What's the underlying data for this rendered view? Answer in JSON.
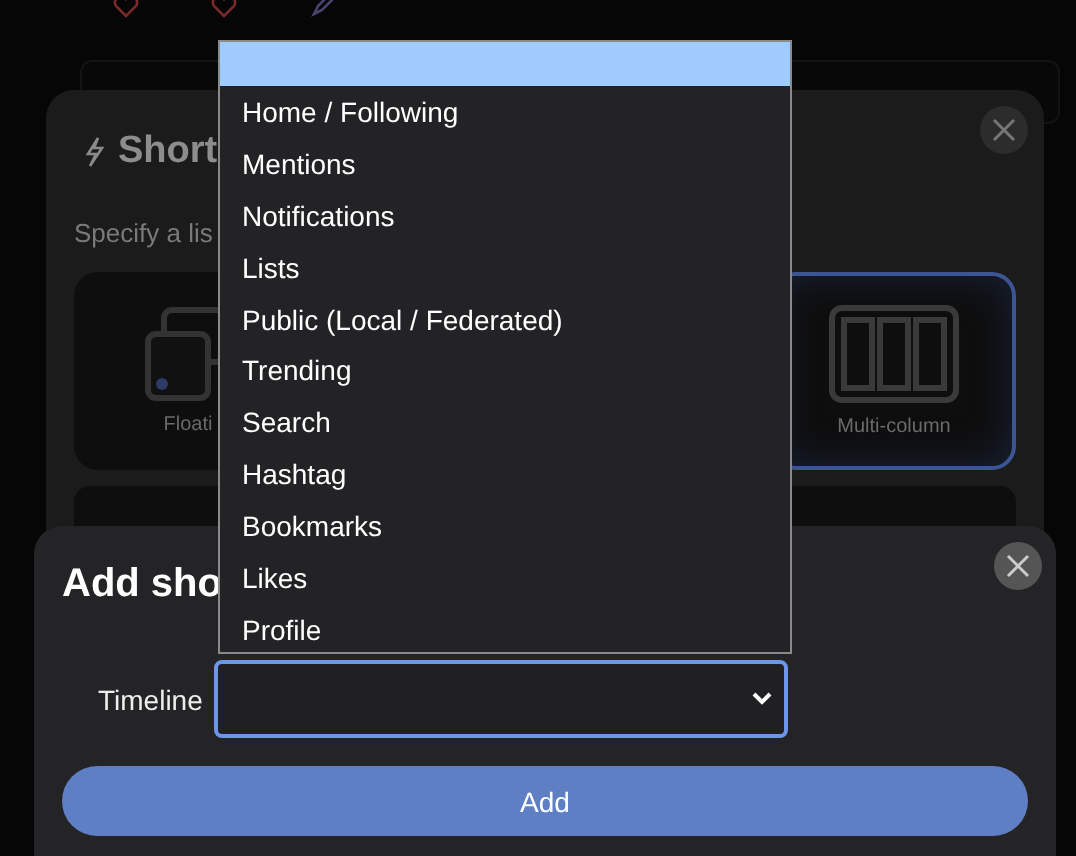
{
  "shortcuts_dialog": {
    "title": "Short",
    "description": "Specify a lis",
    "layouts": [
      {
        "label": "Floati",
        "kind": "floating",
        "selected": false
      },
      {
        "label": "Multi-column",
        "kind": "columns",
        "selected": true
      }
    ]
  },
  "add_dialog": {
    "title": "Add sho",
    "field": {
      "label": "Timeline",
      "focused": true
    },
    "button": "Add"
  },
  "dropdown": {
    "blank_option": {
      "selected": true
    },
    "options": [
      {
        "label": "Home / Following",
        "selected": false
      },
      {
        "label": "Mentions",
        "selected": false
      },
      {
        "label": "Notifications",
        "selected": false
      },
      {
        "label": "Lists",
        "selected": false
      },
      {
        "label": "Public (Local / Federated)",
        "selected": false
      },
      {
        "label": "Trending",
        "selected": false
      },
      {
        "label": "Search",
        "selected": false
      },
      {
        "label": "Hashtag",
        "selected": false
      },
      {
        "label": "Bookmarks",
        "selected": false
      },
      {
        "label": "Likes",
        "selected": false
      },
      {
        "label": "Profile",
        "selected": false
      }
    ]
  }
}
